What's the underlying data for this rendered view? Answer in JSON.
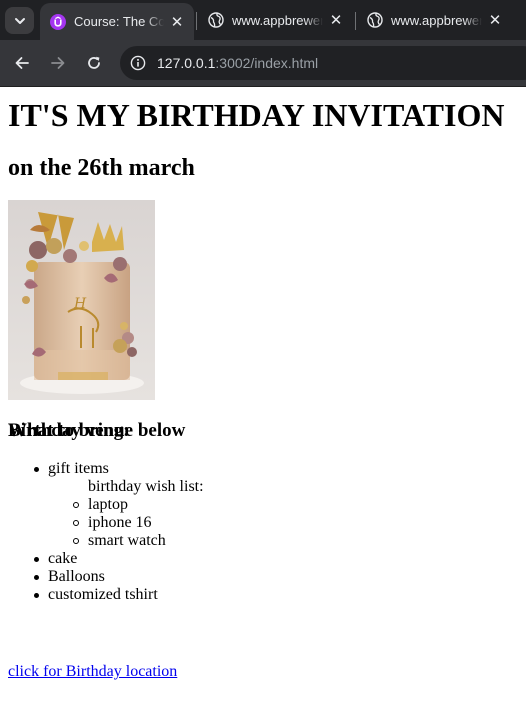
{
  "browser": {
    "tabs": [
      {
        "title": "Course: The Com",
        "icon": "udemy-shield-icon",
        "active": true
      },
      {
        "title": "www.appbrewer",
        "icon": "globe-icon",
        "active": false
      },
      {
        "title": "www.appbrewer",
        "icon": "globe-icon",
        "active": false
      }
    ],
    "close_glyph": "✕",
    "url": {
      "host": "127.0.0.1",
      "path": ":3002/index.html"
    }
  },
  "page": {
    "heading": "IT'S MY BIRTHDAY INVITATION",
    "subheading": "on the 26th march",
    "image_alt": "birthday cake",
    "bring_heading": "What to bring:",
    "bring_items": [
      "gift items",
      "birthday wish list:",
      "laptop",
      "iphone 16",
      "smart watch",
      "cake",
      "Balloons",
      "customized tshirt"
    ],
    "venue_heading": "Birthday venue below",
    "location_link": "click for Birthday location"
  },
  "colors": {
    "chrome_dark": "#202124",
    "chrome_toolbar": "#35363a",
    "link": "#0000ee",
    "udemy_purple": "#a435f0"
  }
}
